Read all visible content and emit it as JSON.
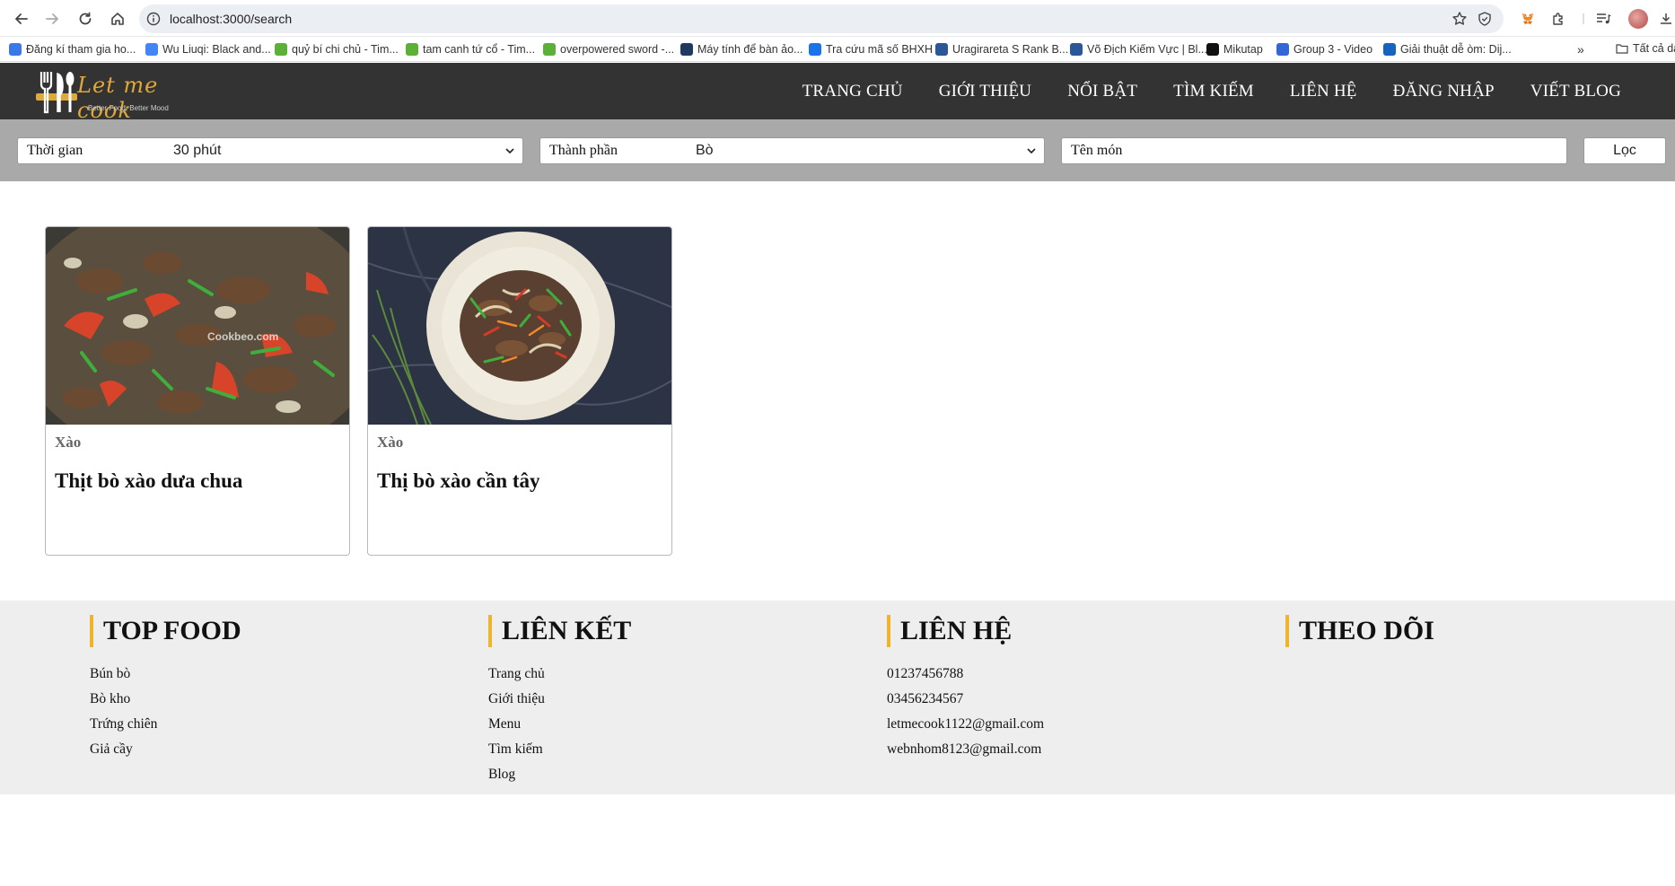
{
  "browser": {
    "url": "localhost:3000/search",
    "bookmarks": [
      {
        "label": "Đăng kí tham gia ho...",
        "color": "#3b78e7"
      },
      {
        "label": "Wu Liuqi: Black and...",
        "color": "#4285f4"
      },
      {
        "label": "quỷ bí chi chủ - Tim...",
        "color": "#5bb138"
      },
      {
        "label": "tam canh tứ cổ - Tim...",
        "color": "#5bb138"
      },
      {
        "label": "overpowered sword -...",
        "color": "#5bb138"
      },
      {
        "label": "Máy tính để bàn ảo...",
        "color": "#1e3a5f"
      },
      {
        "label": "Tra cứu mã số BHXH",
        "color": "#1a73e8"
      },
      {
        "label": "Uragirareta S Rank B...",
        "color": "#2b5797"
      },
      {
        "label": "Võ Địch Kiếm Vực | Bl...",
        "color": "#2b5797"
      },
      {
        "label": "Mikutap",
        "color": "#111111"
      },
      {
        "label": "Group 3 - Video",
        "color": "#3367d6"
      },
      {
        "label": "Giải thuật dễ òm: Dij...",
        "color": "#1565c0"
      }
    ],
    "more_label": "»",
    "all_bookmarks_label": "Tất cả dấ"
  },
  "site": {
    "logo_title": "Let me cook",
    "logo_tagline": "Better Food, Better Mood",
    "nav": [
      "TRANG CHỦ",
      "GIỚI THIỆU",
      "NỔI BẬT",
      "TÌM KIẾM",
      "LIÊN HỆ",
      "ĐĂNG NHẬP",
      "VIẾT BLOG"
    ]
  },
  "filters": {
    "time_label": "Thời gian",
    "time_value": "30 phút",
    "ingredient_label": "Thành phần",
    "ingredient_value": "Bò",
    "name_placeholder": "Tên món",
    "submit_label": "Lọc"
  },
  "results": [
    {
      "category": "Xào",
      "title": "Thịt bò xào dưa chua",
      "watermark": "Cookbeo.com"
    },
    {
      "category": "Xào",
      "title": "Thị bò xào cần tây"
    }
  ],
  "footer": {
    "columns": [
      {
        "heading": "TOP FOOD",
        "items": [
          "Bún bò",
          "Bò kho",
          "Trứng chiên",
          "Giả cầy"
        ]
      },
      {
        "heading": "LIÊN KẾT",
        "items": [
          "Trang chủ",
          "Giới thiệu",
          "Menu",
          "Tìm kiếm",
          "Blog"
        ]
      },
      {
        "heading": "LIÊN HỆ",
        "items": [
          "01237456788",
          "03456234567",
          "letmecook1122@gmail.com",
          "webnhom8123@gmail.com"
        ]
      },
      {
        "heading": "THEO DÕI",
        "items": []
      }
    ]
  },
  "colors": {
    "header_bg": "#333333",
    "filter_bg": "#a9a9a9",
    "footer_bg": "#eeeeee",
    "accent": "#f0b429"
  }
}
